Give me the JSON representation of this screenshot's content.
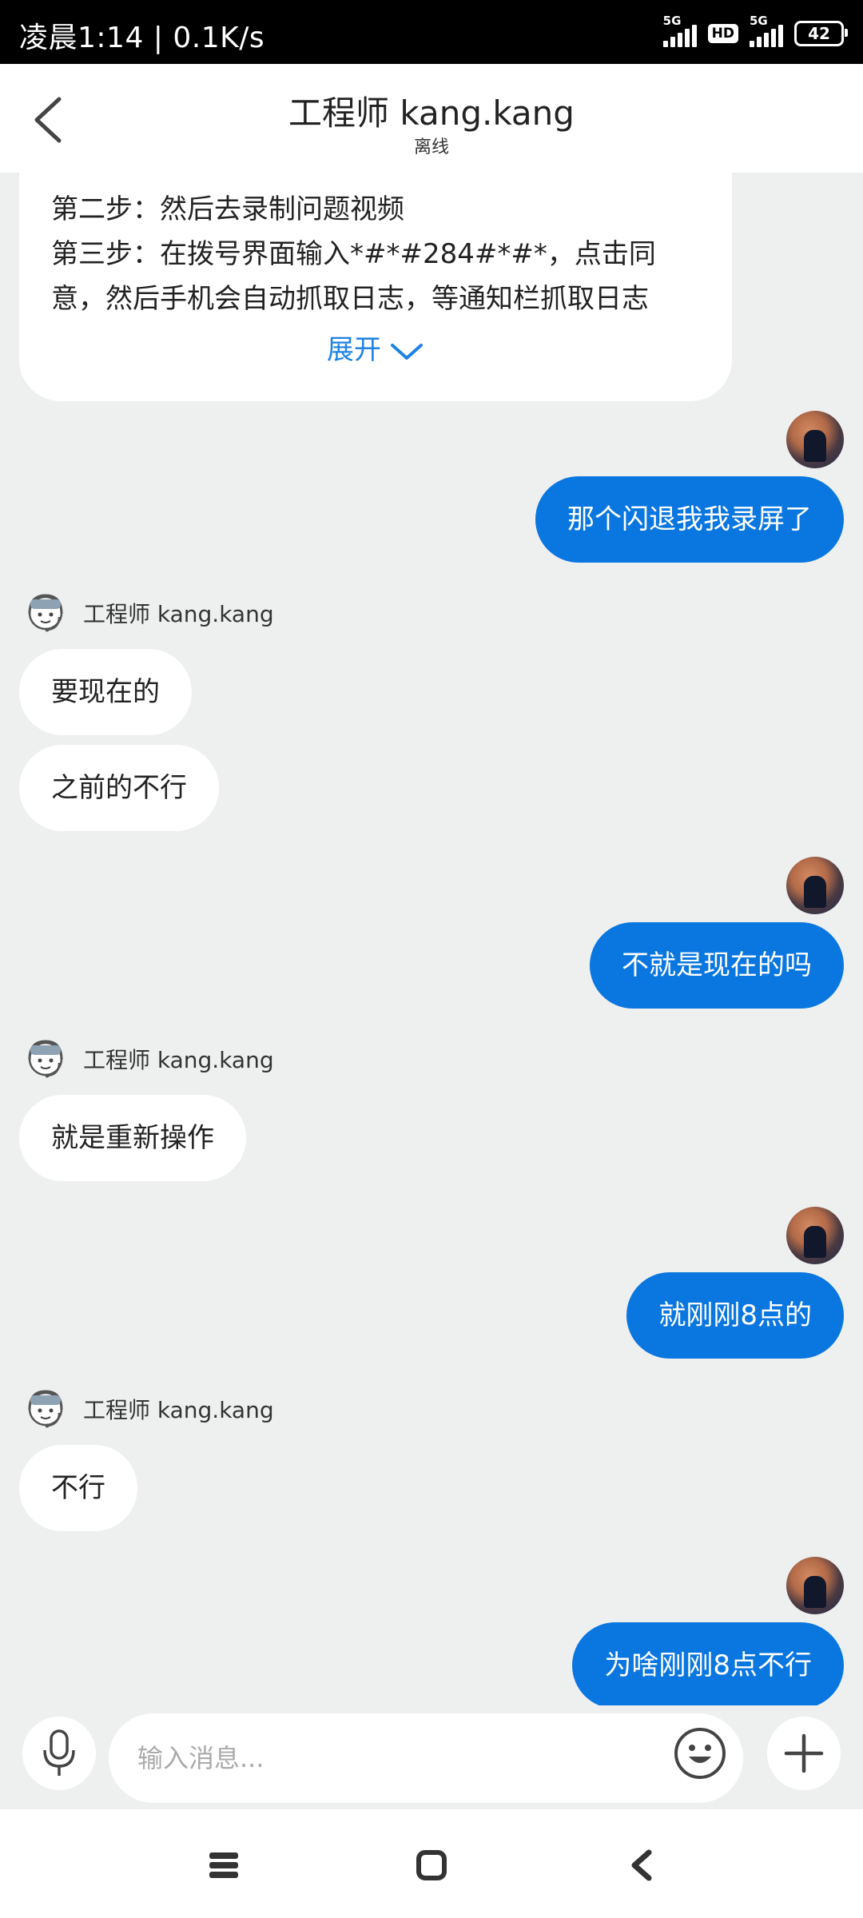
{
  "status_bar": {
    "time_speed": "凌晨1:14 | 0.1K/s",
    "sim1_tag": "5G",
    "hd_badge": "HD",
    "sim2_tag": "5G",
    "battery": "42"
  },
  "header": {
    "title": "工程师 kang.kang",
    "status": "离线",
    "back_icon": "chevron-left-icon"
  },
  "instruction_card": {
    "lines": [
      "第二步：然后去录制问题视频",
      "第三步：在拨号界面输入*#*#284#*#*，点击同",
      "意，然后手机会自动抓取日志，等通知栏抓取日志"
    ],
    "expand_label": "展开",
    "expand_icon": "chevron-down-icon"
  },
  "messages": [
    {
      "from": "me",
      "text": "那个闪退我我录屏了"
    },
    {
      "from": "engineer",
      "sender": "工程师 kang.kang",
      "texts": [
        "要现在的",
        "之前的不行"
      ]
    },
    {
      "from": "me",
      "text": "不就是现在的吗"
    },
    {
      "from": "engineer",
      "sender": "工程师 kang.kang",
      "texts": [
        "就是重新操作"
      ]
    },
    {
      "from": "me",
      "text": "就刚刚8点的"
    },
    {
      "from": "engineer",
      "sender": "工程师 kang.kang",
      "texts": [
        "不行"
      ]
    },
    {
      "from": "me",
      "text": "为啥刚刚8点不行"
    }
  ],
  "input_bar": {
    "placeholder": "输入消息...",
    "voice_icon": "microphone-icon",
    "emoji_icon": "smiley-icon",
    "more_icon": "plus-icon"
  },
  "nav_bar": {
    "menu_icon": "menu-icon",
    "home_icon": "home-square-icon",
    "back_icon": "back-triangle-icon"
  },
  "colors": {
    "accent": "#0a76e0",
    "link": "#1e82e6",
    "background": "#eef0f0"
  }
}
